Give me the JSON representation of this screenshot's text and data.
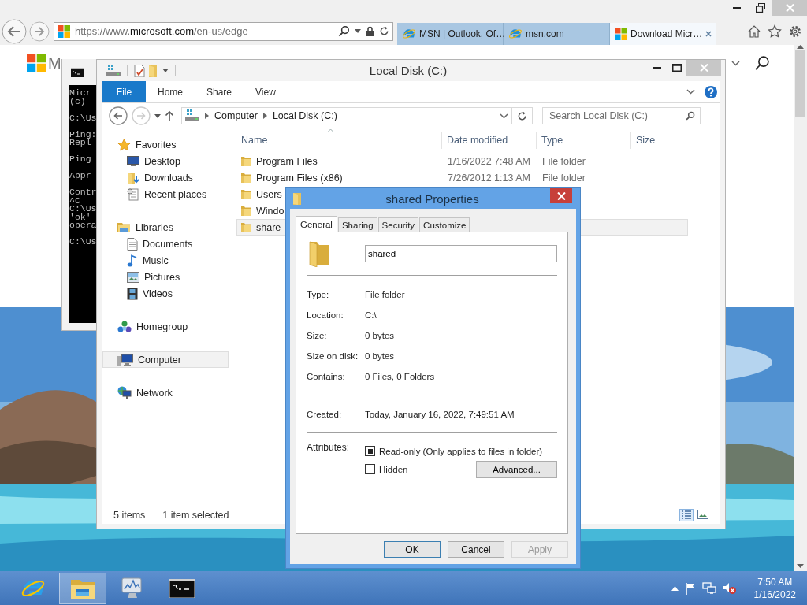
{
  "browser": {
    "address": {
      "prefix": "https://www.",
      "domain": "microsoft.com",
      "path": "/en-us/edge"
    },
    "tabs": [
      {
        "label": "MSN | Outlook, Of…",
        "selected": false
      },
      {
        "label": "msn.com",
        "selected": false
      },
      {
        "label": "Download Micr…",
        "selected": true
      }
    ],
    "logo_text": "M"
  },
  "console": {
    "paragraphs": [
      [
        "Micr",
        "(c)"
      ],
      [
        "C:\\Us"
      ],
      [
        "Ping:",
        "Repl"
      ],
      [
        "Ping"
      ],
      [
        "Appr"
      ],
      [
        "Contr",
        "^C",
        "C:\\Us",
        "'ok'",
        "opera"
      ],
      [
        "C:\\Us"
      ]
    ]
  },
  "explorer": {
    "title": "Local Disk (C:)",
    "ribbon_tabs": [
      {
        "label": "File",
        "kind": "file"
      },
      {
        "label": "Home",
        "kind": "tab"
      },
      {
        "label": "Share",
        "kind": "tab"
      },
      {
        "label": "View",
        "kind": "tab"
      }
    ],
    "breadcrumb": [
      "Computer",
      "Local Disk (C:)"
    ],
    "search_placeholder": "Search Local Disk (C:)",
    "nav": [
      {
        "label": "Favorites",
        "selected": false,
        "children": [
          {
            "label": "Desktop",
            "selected": false
          },
          {
            "label": "Downloads",
            "selected": false
          },
          {
            "label": "Recent places",
            "selected": false
          }
        ]
      },
      {
        "label": "Libraries",
        "selected": false,
        "children": [
          {
            "label": "Documents",
            "selected": false
          },
          {
            "label": "Music",
            "selected": false
          },
          {
            "label": "Pictures",
            "selected": false
          },
          {
            "label": "Videos",
            "selected": false
          }
        ]
      },
      {
        "label": "Homegroup",
        "selected": false
      },
      {
        "label": "Computer",
        "selected": true
      },
      {
        "label": "Network",
        "selected": false
      }
    ],
    "columns": [
      "Name",
      "Date modified",
      "Type",
      "Size"
    ],
    "rows": [
      {
        "name": "Program Files",
        "date": "1/16/2022 7:48 AM",
        "type": "File folder",
        "selected": false
      },
      {
        "name": "Program Files (x86)",
        "date": "7/26/2012 1:13 AM",
        "type": "File folder",
        "selected": false
      },
      {
        "name": "Users",
        "selected": false
      },
      {
        "name": "Windo",
        "selected": false
      },
      {
        "name": "share",
        "selected": true
      }
    ],
    "status": [
      "5 items",
      "1 item selected"
    ]
  },
  "dialog": {
    "title": "shared Properties",
    "tabs": [
      {
        "label": "General",
        "selected": true
      },
      {
        "label": "Sharing",
        "selected": false
      },
      {
        "label": "Security",
        "selected": false
      },
      {
        "label": "Customize",
        "selected": false
      }
    ],
    "name_value": "shared",
    "sections": [
      [
        {
          "label": "Type:",
          "value": "File folder"
        },
        {
          "label": "Location:",
          "value": "C:\\"
        },
        {
          "label": "Size:",
          "value": "0 bytes"
        },
        {
          "label": "Size on disk:",
          "value": "0 bytes"
        },
        {
          "label": "Contains:",
          "value": "0 Files, 0 Folders"
        }
      ],
      [
        {
          "label": "Created:",
          "value": "Today, January 16, 2022, 7:49:51 AM"
        }
      ]
    ],
    "attributes_label": "Attributes:",
    "attributes": [
      {
        "label": "Read-only (Only applies to files in folder)",
        "checked": true
      },
      {
        "label": "Hidden",
        "checked": false
      }
    ],
    "advanced_button": "Advanced...",
    "buttons": [
      {
        "label": "OK",
        "default": true,
        "disabled": false
      },
      {
        "label": "Cancel",
        "default": false,
        "disabled": false
      },
      {
        "label": "Apply",
        "default": false,
        "disabled": true
      }
    ]
  },
  "taskbar": {
    "apps": [
      {
        "kind": "ie",
        "active": false
      },
      {
        "kind": "explorer",
        "active": true
      },
      {
        "kind": "monitor",
        "active": false
      },
      {
        "kind": "console",
        "active": false
      }
    ],
    "time": "7:50 AM",
    "date": "1/16/2022"
  }
}
